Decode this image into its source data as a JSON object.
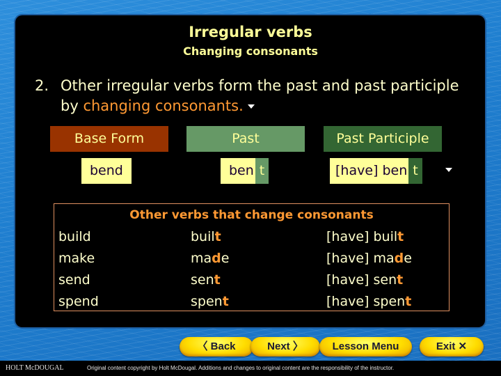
{
  "header": {
    "title": "Irregular verbs",
    "subtitle": "Changing consonants"
  },
  "point": {
    "number": "2.",
    "text_before": "Other irregular verbs form the past and past participle by ",
    "highlight": "changing consonants."
  },
  "columns": {
    "base": "Base Form",
    "past": "Past",
    "past_participle": "Past Participle"
  },
  "example": {
    "base": "bend",
    "past_stem": "ben",
    "past_change": "t",
    "pp_stem": "[have] ben",
    "pp_change": "t"
  },
  "others": {
    "title": "Other verbs that change consonants",
    "rows": [
      {
        "base": "build",
        "past_stem": "buil",
        "past_change": "t",
        "past_rest": "",
        "pp_stem": "[have] buil",
        "pp_change": "t",
        "pp_rest": ""
      },
      {
        "base": "make",
        "past_stem": "ma",
        "past_change": "d",
        "past_rest": "e",
        "pp_stem": "[have] ma",
        "pp_change": "d",
        "pp_rest": "e"
      },
      {
        "base": "send",
        "past_stem": "sen",
        "past_change": "t",
        "past_rest": "",
        "pp_stem": "[have] sen",
        "pp_change": "t",
        "pp_rest": ""
      },
      {
        "base": "spend",
        "past_stem": "spen",
        "past_change": "t",
        "past_rest": "",
        "pp_stem": "[have] spen",
        "pp_change": "t",
        "pp_rest": ""
      }
    ]
  },
  "nav": {
    "back": "〈 Back",
    "next": "Next 〉",
    "lesson_menu": "Lesson Menu",
    "exit": "Exit ✕"
  },
  "footer": {
    "logo": "HOLT McDOUGAL",
    "copyright": "Original content copyright by Holt McDougal. Additions and changes to original content are the responsibility of the instructor."
  },
  "colors": {
    "title": "#ffff99",
    "highlight": "#ff9933",
    "base_header": "#993300",
    "past_header": "#669966",
    "pp_header": "#336633"
  }
}
